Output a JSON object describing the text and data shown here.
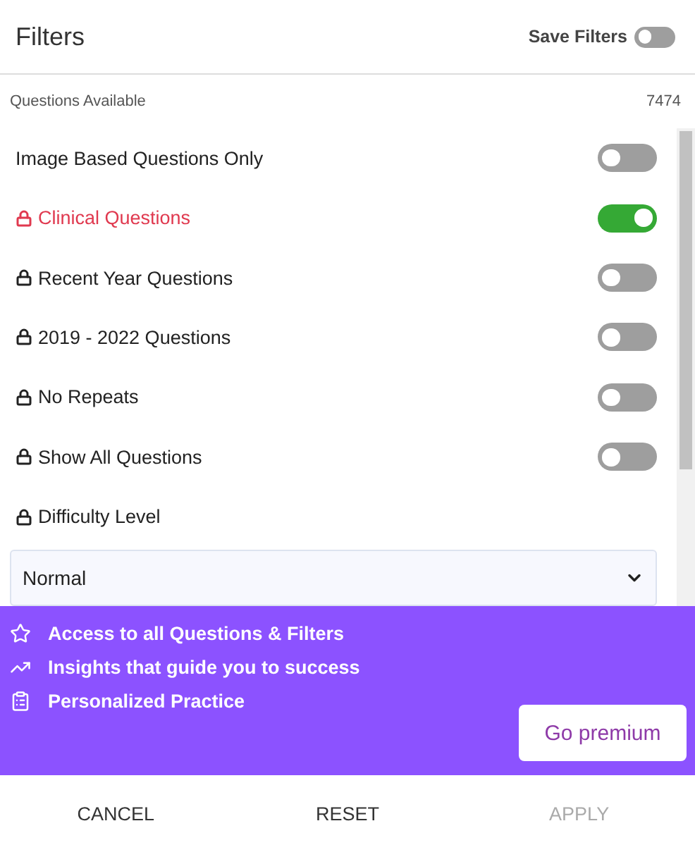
{
  "header": {
    "title": "Filters",
    "save_filters": {
      "label": "Save Filters",
      "on": false
    }
  },
  "available": {
    "label": "Questions Available",
    "count": "7474"
  },
  "filters": [
    {
      "label": "Image Based Questions Only",
      "locked": false,
      "highlighted": false,
      "on": false
    },
    {
      "label": "Clinical Questions",
      "locked": true,
      "highlighted": true,
      "on": true
    },
    {
      "label": "Recent Year Questions",
      "locked": true,
      "highlighted": false,
      "on": false
    },
    {
      "label": "2019 - 2022 Questions",
      "locked": true,
      "highlighted": false,
      "on": false
    },
    {
      "label": "No Repeats",
      "locked": true,
      "highlighted": false,
      "on": false
    },
    {
      "label": "Show All Questions",
      "locked": true,
      "highlighted": false,
      "on": false
    }
  ],
  "difficulty": {
    "label": "Difficulty Level",
    "locked": true,
    "value": "Normal"
  },
  "premium": {
    "features": [
      {
        "kind": "star",
        "text": "Access to all Questions & Filters"
      },
      {
        "kind": "trend",
        "text": "Insights that guide you to success"
      },
      {
        "kind": "clipboard",
        "text": "Personalized Practice"
      }
    ],
    "button": "Go premium"
  },
  "footer": [
    {
      "label": "CANCEL",
      "disabled": false
    },
    {
      "label": "RESET",
      "disabled": false
    },
    {
      "label": "APPLY",
      "disabled": true
    }
  ]
}
